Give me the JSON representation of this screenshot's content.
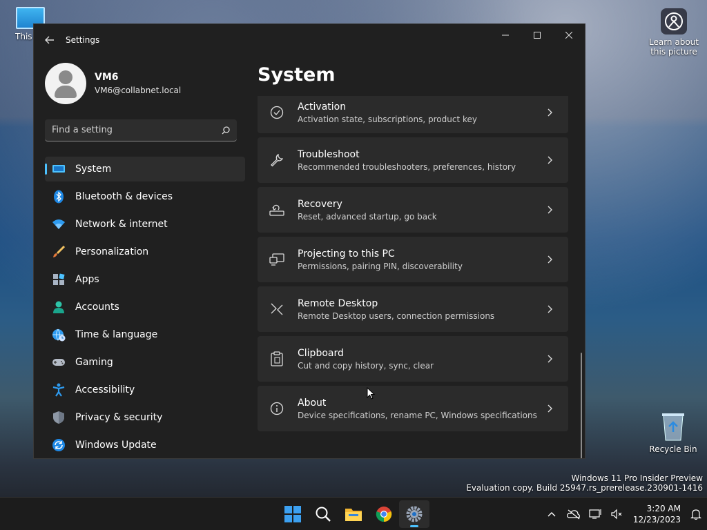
{
  "desktop": {
    "icons": [
      {
        "label": "This PC"
      },
      {
        "label": "Learn about this picture"
      },
      {
        "label": "Recycle Bin"
      }
    ],
    "watermark": {
      "line1": "Windows 11 Pro Insider Preview",
      "line2": "Evaluation copy. Build 25947.rs_prerelease.230901-1416"
    }
  },
  "window": {
    "title": "Settings",
    "accent": "#4cc2ff"
  },
  "profile": {
    "name": "VM6",
    "email": "VM6@collabnet.local"
  },
  "search": {
    "placeholder": "Find a setting",
    "value": ""
  },
  "sidebar": {
    "items": [
      {
        "label": "System",
        "icon": "system-icon",
        "selected": true
      },
      {
        "label": "Bluetooth & devices",
        "icon": "bluetooth-icon"
      },
      {
        "label": "Network & internet",
        "icon": "wifi-icon"
      },
      {
        "label": "Personalization",
        "icon": "brush-icon"
      },
      {
        "label": "Apps",
        "icon": "apps-icon"
      },
      {
        "label": "Accounts",
        "icon": "person-icon"
      },
      {
        "label": "Time & language",
        "icon": "globe-clock-icon"
      },
      {
        "label": "Gaming",
        "icon": "gamepad-icon"
      },
      {
        "label": "Accessibility",
        "icon": "accessibility-icon"
      },
      {
        "label": "Privacy & security",
        "icon": "shield-icon"
      },
      {
        "label": "Windows Update",
        "icon": "update-icon"
      }
    ]
  },
  "main": {
    "title": "System",
    "cards": [
      {
        "title": "Activation",
        "desc": "Activation state, subscriptions, product key",
        "icon": "check-circle-icon"
      },
      {
        "title": "Troubleshoot",
        "desc": "Recommended troubleshooters, preferences, history",
        "icon": "wrench-icon"
      },
      {
        "title": "Recovery",
        "desc": "Reset, advanced startup, go back",
        "icon": "recovery-icon"
      },
      {
        "title": "Projecting to this PC",
        "desc": "Permissions, pairing PIN, discoverability",
        "icon": "projecting-icon"
      },
      {
        "title": "Remote Desktop",
        "desc": "Remote Desktop users, connection permissions",
        "icon": "remote-desktop-icon"
      },
      {
        "title": "Clipboard",
        "desc": "Cut and copy history, sync, clear",
        "icon": "clipboard-icon"
      },
      {
        "title": "About",
        "desc": "Device specifications, rename PC, Windows specifications",
        "icon": "info-icon"
      }
    ]
  },
  "taskbar": {
    "apps": [
      "start-icon",
      "search-icon",
      "file-explorer-icon",
      "chrome-icon",
      "settings-icon"
    ],
    "time": "3:20 AM",
    "date": "12/23/2023"
  }
}
